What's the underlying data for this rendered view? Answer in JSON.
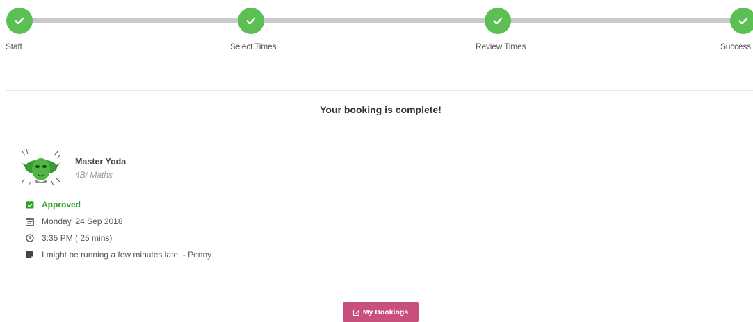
{
  "stepper": {
    "steps": [
      {
        "label": "Staff",
        "icon": "check-icon",
        "done": true
      },
      {
        "label": "Select Times",
        "icon": "check-icon",
        "done": true
      },
      {
        "label": "Review Times",
        "icon": "check-icon",
        "done": true
      },
      {
        "label": "Success",
        "icon": "check-icon",
        "done": true
      }
    ],
    "color": "#5cbf54"
  },
  "main": {
    "title": "Your booking is complete!"
  },
  "booking": {
    "staff_name": "Master Yoda",
    "staff_subtitle": "4B/ Maths",
    "status": "Approved",
    "status_color": "#2fa52a",
    "date": "Monday, 24 Sep 2018",
    "time": "3:35 PM ( 25 mins)",
    "note": "I might be running a few minutes late. - Penny"
  },
  "actions": {
    "my_bookings_label": "My Bookings",
    "button_color": "#c94f7c"
  }
}
